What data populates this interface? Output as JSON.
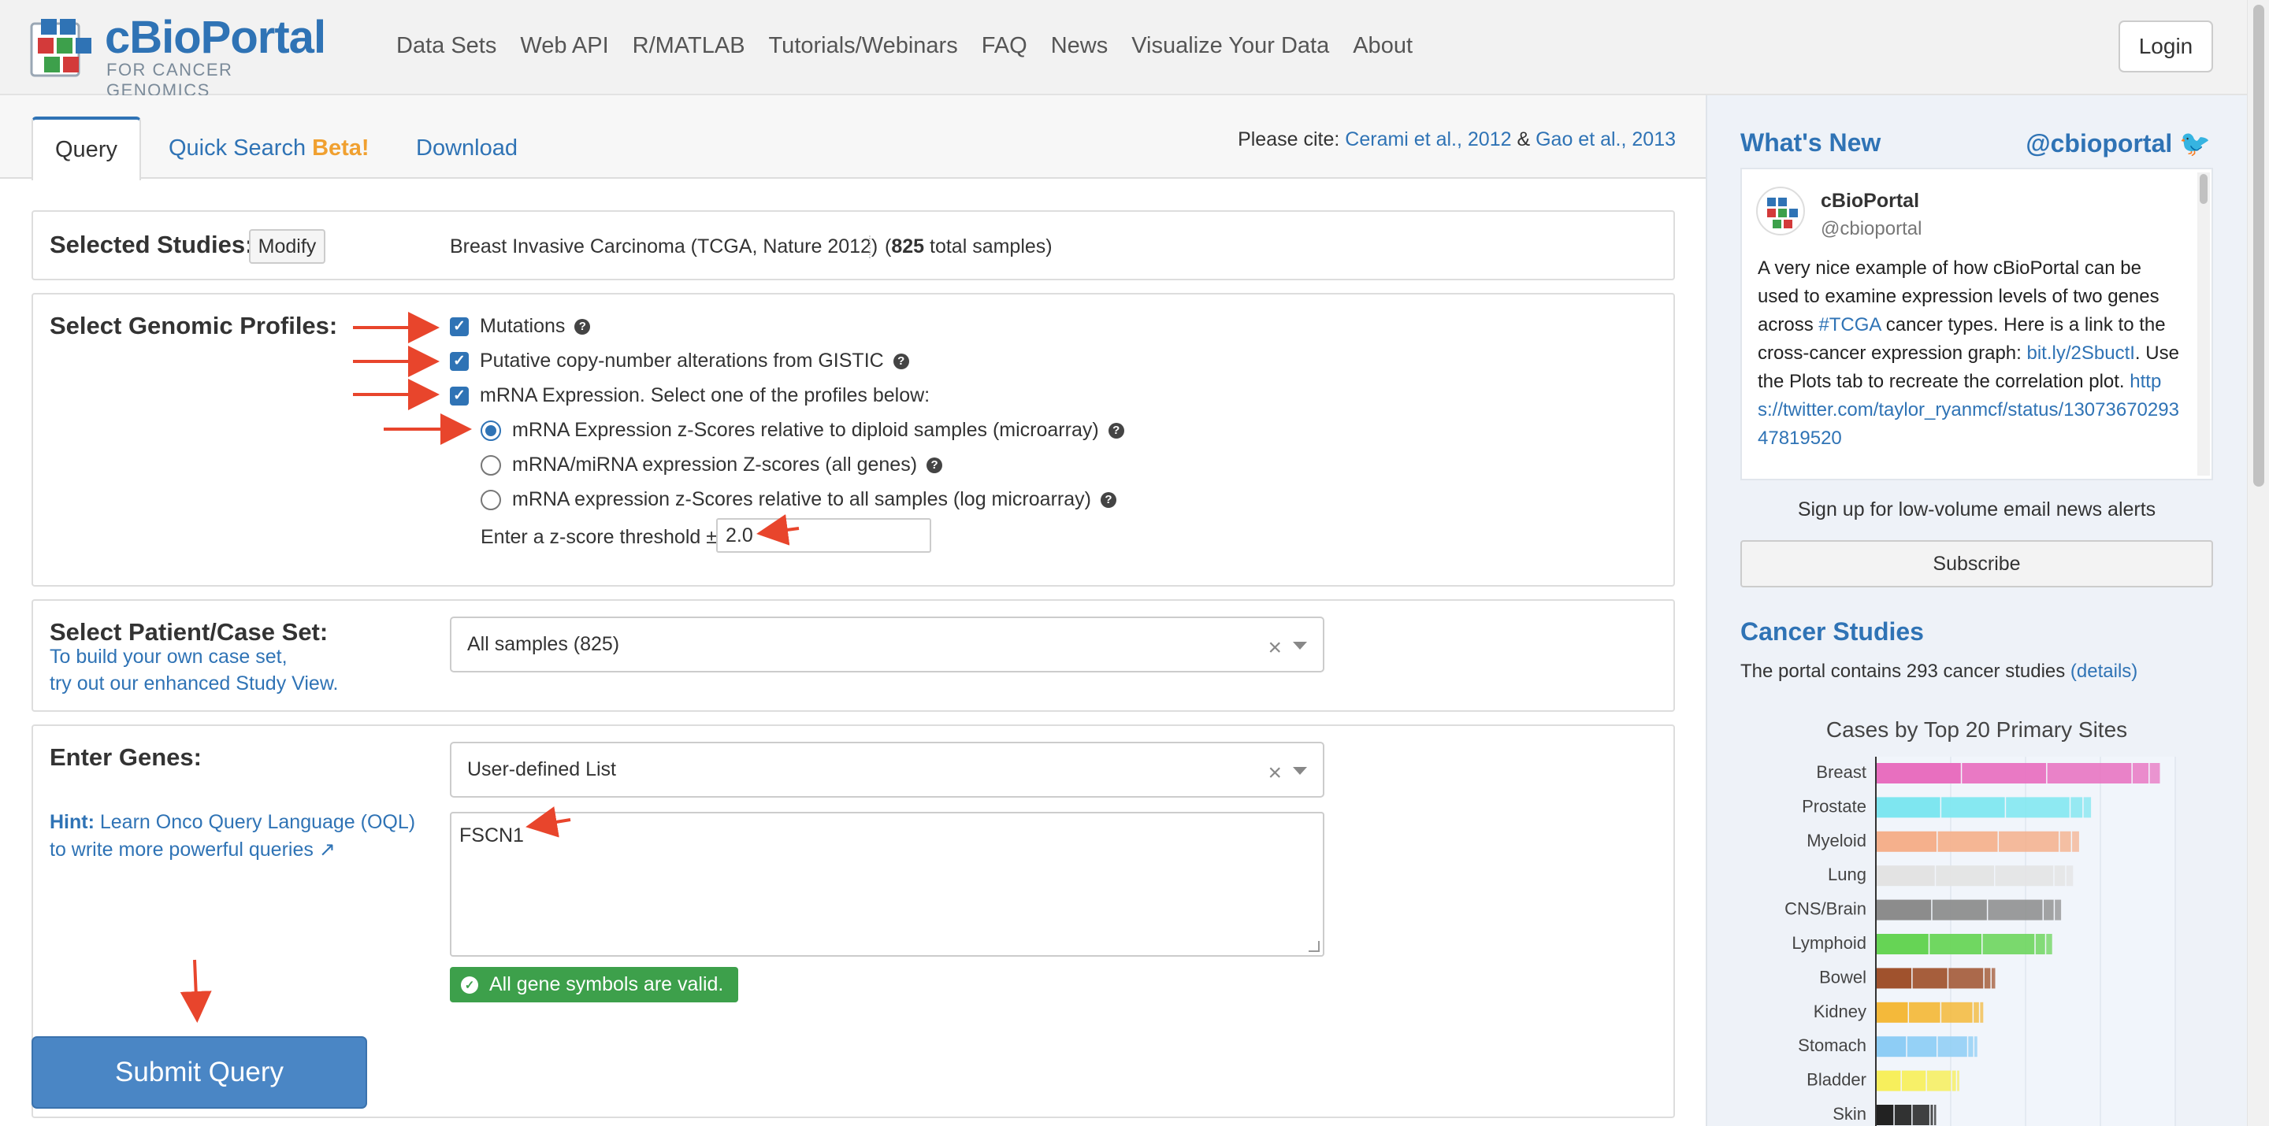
{
  "header": {
    "brand": "cBioPortal",
    "brand_sub": "FOR CANCER GENOMICS",
    "nav": [
      "Data Sets",
      "Web API",
      "R/MATLAB",
      "Tutorials/Webinars",
      "FAQ",
      "News",
      "Visualize Your Data",
      "About"
    ],
    "login_label": "Login"
  },
  "tabs": {
    "query": "Query",
    "quick_search": "Quick Search",
    "quick_search_badge": "Beta!",
    "download": "Download"
  },
  "cite": {
    "prefix": "Please cite:",
    "ref1": "Cerami et al., 2012",
    "amp": "&",
    "ref2": "Gao et al., 2013"
  },
  "studies": {
    "title": "Selected Studies:",
    "modify_label": "Modify",
    "study_name": "Breast Invasive Carcinoma (TCGA, Nature 2012)",
    "count_open": "(",
    "count": "825",
    "count_suffix": "total samples)"
  },
  "profiles": {
    "title": "Select Genomic Profiles:",
    "mutations": "Mutations",
    "cna": "Putative copy-number alterations from GISTIC",
    "mrna": "mRNA Expression. Select one of the profiles below:",
    "mrna_options": [
      "mRNA Expression z-Scores relative to diploid samples (microarray)",
      "mRNA/miRNA expression Z-scores (all genes)",
      "mRNA expression z-Scores relative to all samples (log microarray)"
    ],
    "selected_option": 0,
    "zscore_label": "Enter a z-score threshold ±",
    "zscore_value": "2.0"
  },
  "caseset": {
    "title": "Select Patient/Case Set:",
    "hint_line1": "To build your own case set,",
    "hint_line2": "try out our enhanced Study View.",
    "selected": "All samples (825)"
  },
  "genes": {
    "title": "Enter Genes:",
    "hint_label": "Hint:",
    "hint_line1": "Learn Onco Query Language (OQL)",
    "hint_line2": "to write more powerful queries",
    "list_selected": "User-defined List",
    "gene_text": "FSCN1",
    "valid_message": "All gene symbols are valid."
  },
  "submit_label": "Submit Query",
  "sidebar": {
    "whats_new": "What's New",
    "handle": "@cbioportal",
    "tweet": {
      "name": "cBioPortal",
      "handle": "@cbioportal",
      "text_a": "A very nice example of how cBioPortal can be used to examine expression levels of two genes across",
      "hashtag": "#TCGA",
      "text_b": "cancer types. Here is a link to the cross-cancer expression graph:",
      "short_link": "bit.ly/2SbuctI",
      "text_c": ". Use the Plots tab to recreate the correlation plot.",
      "long_link": "https://twitter.com/taylor_ryanmcf/status/1307367029347819520"
    },
    "signup_text": "Sign up for low-volume email news alerts",
    "subscribe_label": "Subscribe",
    "cancer_studies_title": "Cancer Studies",
    "cancer_studies_text": "The portal contains 293 cancer studies",
    "details_link": "(details)"
  },
  "chart_data": {
    "type": "bar",
    "title": "Cases by Top 20 Primary Sites",
    "categories": [
      "Breast",
      "Prostate",
      "Myeloid",
      "Lung",
      "CNS/Brain",
      "Lymphoid",
      "Bowel",
      "Kidney",
      "Stomach",
      "Bladder",
      "Skin"
    ],
    "colors": [
      "#e86fbf",
      "#7ee6f0",
      "#f5b08c",
      "#e3e3e3",
      "#8c8c8c",
      "#66d455",
      "#a0522d",
      "#f4b93a",
      "#8ecdf5",
      "#f7ef5c",
      "#222222"
    ],
    "values": [
      95,
      72,
      68,
      66,
      62,
      59,
      40,
      36,
      34,
      28,
      20
    ],
    "xlim": [
      0,
      100
    ]
  }
}
